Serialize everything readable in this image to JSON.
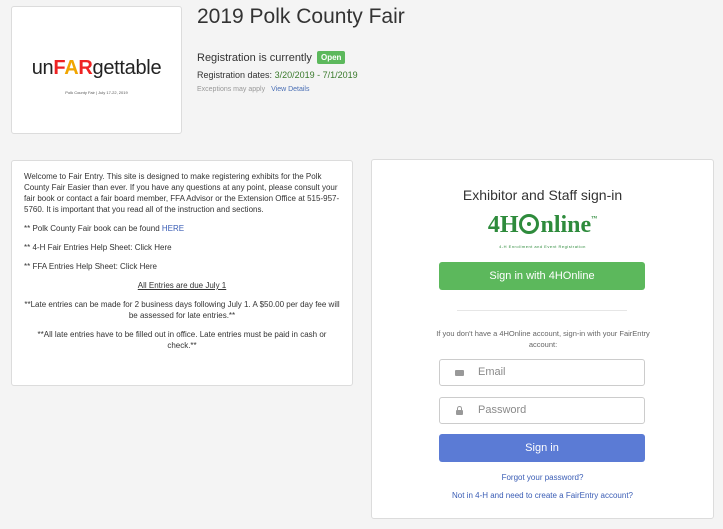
{
  "logo": {
    "word_prefix": "un",
    "word_fair_f": "F",
    "word_fair_a": "A",
    "word_fair_r": "R",
    "word_suffix": "gettable",
    "subtitle": "Polk County Fair | July 17-22, 2019"
  },
  "header": {
    "title": "2019 Polk County Fair",
    "registration_text": "Registration is currently",
    "status_badge": "Open",
    "dates_label": "Registration dates:",
    "dates_value": "3/20/2019 - 7/1/2019",
    "exceptions_text": "Exceptions may apply",
    "view_details_link": "View Details"
  },
  "info": {
    "welcome": "Welcome to Fair Entry. This site is designed to make registering exhibits for the Polk County Fair Easier than ever. If you have any questions at any point, please consult your fair book or contact a fair board member, FFA Advisor or the Extension Office at 515-957-5760. It is important that you read all of the instruction and sections.",
    "fairbook_text": "** Polk County Fair book can be found ",
    "fairbook_link": "HERE",
    "help_4h": "** 4-H Fair Entries Help Sheet: Click Here",
    "help_ffa": "** FFA Entries Help Sheet: Click Here",
    "due": "All Entries are due July 1",
    "late1": "**Late entries can be made for 2 business days following July 1. A $50.00 per day fee will be assessed for late entries.**",
    "late2": "**All late entries have to be filled out in office. Late entries must be paid in cash or check.**"
  },
  "signin": {
    "title": "Exhibitor and Staff sign-in",
    "fourh_logo_pre": "4H",
    "fourh_logo_post": "nline",
    "fourh_tm": "™",
    "fourh_sub": "4-H Enrollment and Event Registration",
    "fourh_button": "Sign in with 4HOnline",
    "alt_text": "If you don't have a 4HOnline account, sign-in with your FairEntry account:",
    "email_placeholder": "Email",
    "password_placeholder": "Password",
    "signin_button": "Sign in",
    "forgot_link": "Forgot your password?",
    "create_link": "Not in 4-H and need to create a FairEntry account?"
  },
  "colors": {
    "open_badge": "#5cb85c",
    "fourh_green": "#2e8b3c",
    "signin_blue": "#5b7bd5",
    "link_blue": "#3a5db5"
  }
}
